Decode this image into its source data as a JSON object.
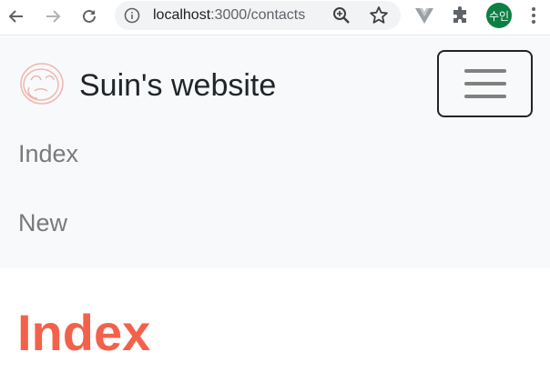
{
  "browser": {
    "url_host": "localhost",
    "url_path": ":3000/contacts",
    "profile_initials": "수인",
    "icons": [
      "back-arrow-icon",
      "forward-arrow-icon",
      "reload-icon",
      "info-icon",
      "zoom-icon",
      "star-icon",
      "vue-devtools-icon",
      "puzzle-icon",
      "menu-dots-icon"
    ]
  },
  "navbar": {
    "brand": "Suin's website",
    "links": [
      {
        "label": "Index"
      },
      {
        "label": "New"
      }
    ]
  },
  "main": {
    "title": "Index"
  },
  "colors": {
    "accent": "#f4614b",
    "navbar_bg": "#f8f9fa",
    "link": "#7a7a7a",
    "brand_text": "#212529",
    "profile": "#0b8043"
  }
}
